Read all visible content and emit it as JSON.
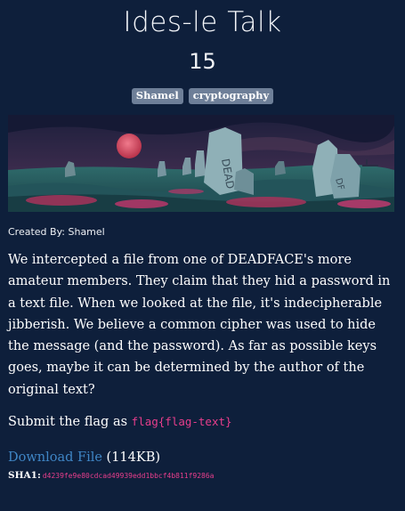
{
  "challenge": {
    "title": "Ides-le Talk",
    "points": "15",
    "tags": [
      "Shamel",
      "cryptography"
    ],
    "created_by": "Created By: Shamel",
    "description": "We intercepted a file from one of DEADFACE's more amateur members. They claim that they hid a password in a text file. When we looked at the file, it's indecipherable jibberish. We believe a common cipher was used to hide the message (and the password). As far as possible keys goes, maybe it can be determined by the author of the original text?",
    "submit_prefix": "Submit the flag as ",
    "flag_format": "flag{flag-text}",
    "download_label": "Download File",
    "download_size": "(114KB)",
    "sha_label": "SHA1:",
    "sha_value": "d4239fe9e80cdcad49939edd1bbcf4b811f9286a"
  },
  "colors": {
    "background": "#0e1f3b",
    "tag_background": "#6e7f98",
    "link": "#3f86c6",
    "code": "#e83e8c"
  }
}
